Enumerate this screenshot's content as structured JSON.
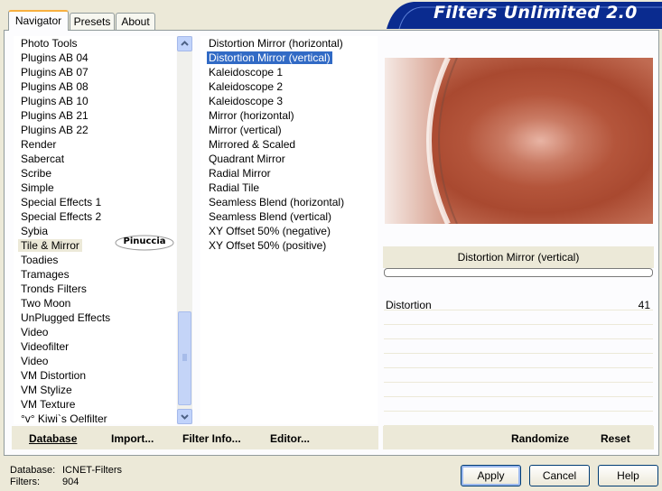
{
  "app_title": "Filters Unlimited 2.0",
  "tabs": [
    {
      "label": "Navigator",
      "active": true
    },
    {
      "label": "Presets",
      "active": false
    },
    {
      "label": "About",
      "active": false
    }
  ],
  "categories": [
    "Photo Tools",
    "Plugins AB 04",
    "Plugins AB 07",
    "Plugins AB 08",
    "Plugins AB 10",
    "Plugins AB 21",
    "Plugins AB 22",
    "Render",
    "Sabercat",
    "Scribe",
    "Simple",
    "Special Effects 1",
    "Special Effects 2",
    "Sybia",
    "Tile & Mirror",
    "Toadies",
    "Tramages",
    "Tronds Filters",
    "Two Moon",
    "UnPlugged Effects",
    "Video",
    "Videofilter",
    "Video",
    "VM Distortion",
    "VM Stylize",
    "VM Texture",
    "°v° Kiwi`s Oelfilter"
  ],
  "selected_category": "Tile & Mirror",
  "watermark_text": "Pinuccia",
  "filters": [
    "Distortion Mirror (horizontal)",
    "Distortion Mirror (vertical)",
    "Kaleidoscope 1",
    "Kaleidoscope 2",
    "Kaleidoscope 3",
    "Mirror (horizontal)",
    "Mirror (vertical)",
    "Mirrored & Scaled",
    "Quadrant Mirror",
    "Radial Mirror",
    "Radial Tile",
    "Seamless Blend (horizontal)",
    "Seamless Blend (vertical)",
    "XY Offset 50% (negative)",
    "XY Offset 50% (positive)"
  ],
  "selected_filter": "Distortion Mirror (vertical)",
  "filter_title": "Distortion Mirror (vertical)",
  "param": {
    "label": "Distortion",
    "value": "41"
  },
  "toolbar": {
    "database": "Database",
    "import": "Import...",
    "filter_info": "Filter Info...",
    "editor": "Editor...",
    "randomize": "Randomize",
    "reset": "Reset"
  },
  "status": {
    "database_label": "Database:",
    "database_value": "ICNET-Filters",
    "filters_label": "Filters:",
    "filters_value": "904"
  },
  "buttons": {
    "apply": "Apply",
    "cancel": "Cancel",
    "help": "Help"
  },
  "colors": {
    "selection": "#316ac5",
    "banner": "#0a2b8f",
    "tab_highlight": "#f8b040"
  }
}
